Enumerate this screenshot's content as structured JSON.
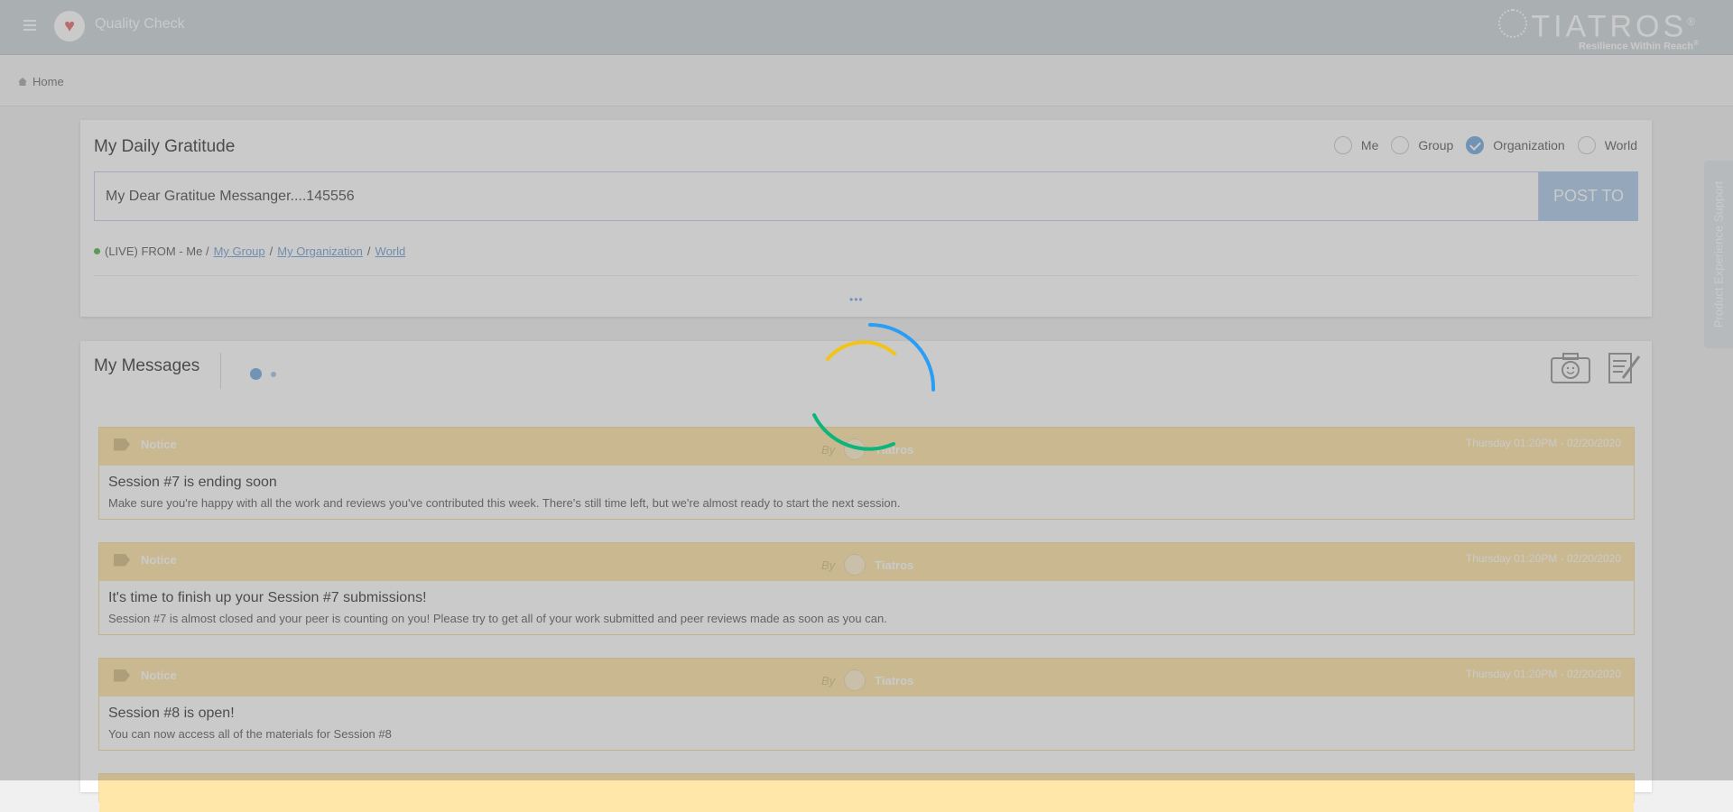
{
  "header": {
    "app_title": "Quality Check",
    "brand_name": "TIATROS",
    "brand_mark": "®",
    "brand_tagline": "Resilience Within Reach",
    "brand_tagline_mark": "®",
    "menu_icon": "hamburger-icon",
    "logo_icon": "heart-icon"
  },
  "breadcrumb": {
    "home_label": "Home",
    "icon": "home-icon"
  },
  "gratitude": {
    "title": "My Daily Gratitude",
    "audience_options": [
      {
        "label": "Me",
        "checked": false
      },
      {
        "label": "Group",
        "checked": false
      },
      {
        "label": "Organization",
        "checked": true
      },
      {
        "label": "World",
        "checked": false
      }
    ],
    "input_value": "My Dear Gratitue Messanger....145556",
    "post_button": "POST TO",
    "live_prefix": "(LIVE) FROM - Me /",
    "live_links": [
      "My Group",
      "My Organization",
      "World"
    ],
    "separator": "/",
    "more_label": "•••"
  },
  "messages": {
    "title": "My Messages",
    "camera_icon": "camera-icon",
    "edit_icon": "edit-note-icon",
    "items": [
      {
        "tag": "Notice",
        "by_label": "By",
        "author": "Tiatros",
        "date": "Thursday 01:20PM - 02/20/2020",
        "title": "Session #7 is ending soon",
        "body": "Make sure you're happy with all the work and reviews you've contributed this week. There's still time left, but we're almost ready to start the next session."
      },
      {
        "tag": "Notice",
        "by_label": "By",
        "author": "Tiatros",
        "date": "Thursday 01:20PM - 02/20/2020",
        "title": "It's time to finish up your Session #7 submissions!",
        "body": "Session #7 is almost closed and your peer is counting on you! Please try to get all of your work submitted and peer reviews made as soon as you can."
      },
      {
        "tag": "Notice",
        "by_label": "By",
        "author": "Tiatros",
        "date": "Thursday 01:20PM - 02/20/2020",
        "title": "Session #8 is open!",
        "body": "You can now access all of the materials for Session #8"
      }
    ]
  },
  "side_tab": {
    "label": "Product Experience Support"
  },
  "colors": {
    "accent": "#7baee0",
    "notice_header": "#ffe6a9",
    "spinner_blue": "#2a9df4",
    "spinner_yellow": "#f2c418",
    "spinner_green": "#0fb47a"
  }
}
